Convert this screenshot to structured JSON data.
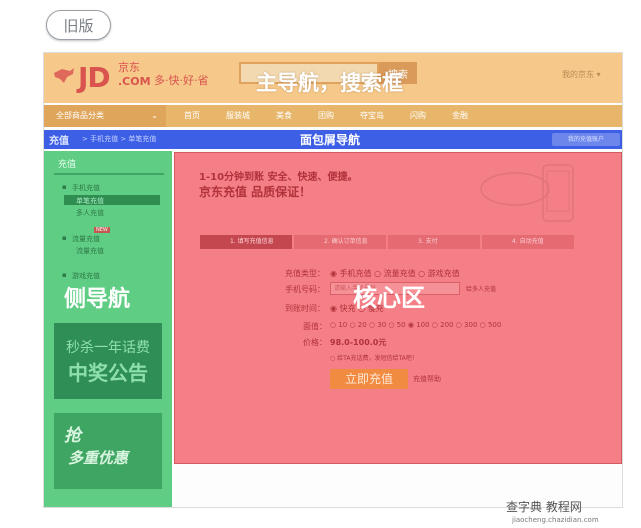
{
  "old_version_label": "旧版",
  "header": {
    "logo_text": "JD",
    "logo_cn": "京东",
    "logo_com": ".COM",
    "slogan": "多·快·好·省",
    "search_button": "搜索",
    "user_link": "我的京东 ▾",
    "overlay_label": "主导航，搜索框"
  },
  "nav": {
    "all_label": "全部商品分类",
    "items": [
      "首页",
      "服装城",
      "美食",
      "团购",
      "夺宝岛",
      "闪购",
      "金融"
    ]
  },
  "crumbs": {
    "title": "充值",
    "path": "> 手机充值 > 单笔充值",
    "overlay_label": "面包屑导航",
    "right_button": "我的充值账户"
  },
  "sidebar": {
    "head": "充值",
    "items": [
      {
        "label": "手机充值",
        "sub": [
          "单笔充值",
          "多人充值"
        ]
      },
      {
        "label": "流量充值",
        "sub": [
          "流量充值"
        ]
      },
      {
        "label": "游戏充值",
        "sub": []
      }
    ],
    "badge": "NEW",
    "overlay_label": "侧导航",
    "seckill_line1": "秒杀一年话费",
    "seckill_line2": "中奖公告",
    "promo_line1": "抢",
    "promo_line2": "多重优惠"
  },
  "core": {
    "banner_line1": "1-10分钟到账 安全、快速、便捷。",
    "banner_line2": "京东充值 品质保证！",
    "steps": [
      "1. 填写充值信息",
      "2. 确认订单信息",
      "3. 支付",
      "4. 自动充值"
    ],
    "type_label": "充值类型：",
    "type_options": "◉ 手机充值   ○ 流量充值   ○ 游戏充值",
    "phone_label": "手机号码：",
    "phone_placeholder": "请输入手机号码",
    "phone_extra": "给多人充值",
    "time_label": "到账时间：",
    "time_options": "◉ 快充   ○ 慢充",
    "face_label": "面值：",
    "face_options": "○ 10   ○ 20   ○ 30   ○ 50   ◉ 100   ○ 200   ○ 300   ○ 500",
    "price_label": "价格：",
    "price_value": "98.0-100.0元",
    "ta_option": "○ 给TA充话费，发短信给TA吧！",
    "button_label": "立即充值",
    "help_link": "充值帮助",
    "overlay_label": "核心区"
  },
  "watermark": {
    "line1": "查字典 教程网",
    "line2": "jiaocheng.chazidian.com"
  }
}
